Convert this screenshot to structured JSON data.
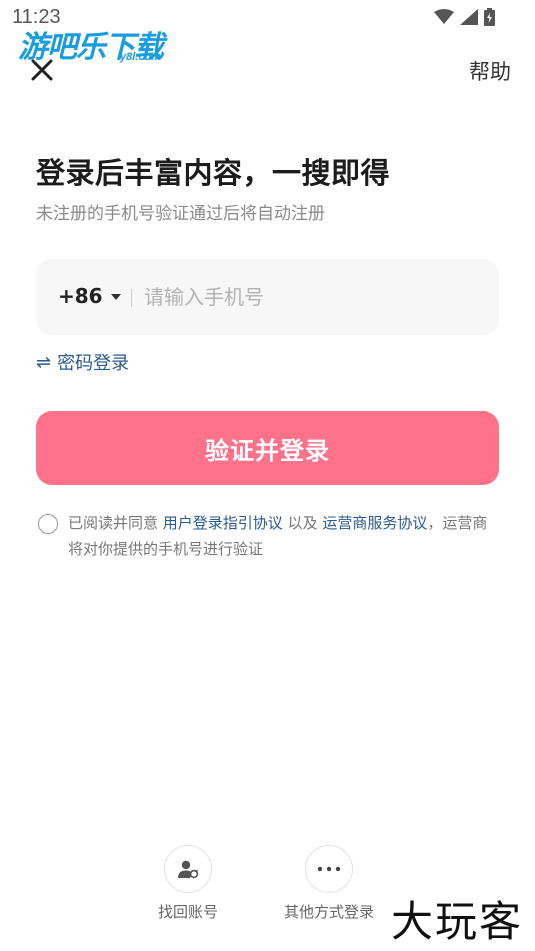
{
  "status_bar": {
    "time": "11:23"
  },
  "watermark": {
    "logo_text": "游吧乐下载",
    "logo_sub": "y8l.com",
    "bottom_text": "大玩客"
  },
  "header": {
    "help_label": "帮助"
  },
  "title": "登录后丰富内容，一搜即得",
  "subtitle": "未注册的手机号验证通过后将自动注册",
  "phone": {
    "country_code": "+86",
    "placeholder": "请输入手机号",
    "value": ""
  },
  "password_login": {
    "icon": "⇌",
    "label": "密码登录"
  },
  "submit_label": "验证并登录",
  "agreement": {
    "prefix": "已阅读并同意",
    "link1": "用户登录指引协议",
    "middle": "以及",
    "link2": "运营商服务协议",
    "suffix": "，运营商将对你提供的手机号进行验证"
  },
  "bottom_options": [
    {
      "label": "找回账号",
      "icon": "user-recover-icon"
    },
    {
      "label": "其他方式登录",
      "icon": "more-dots-icon"
    }
  ],
  "colors": {
    "primary_button": "#ff7289",
    "link": "#2a5a92",
    "input_bg": "#f7f7f7"
  }
}
